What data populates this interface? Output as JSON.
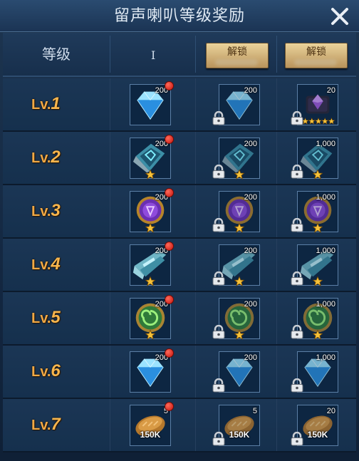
{
  "title": "留声喇叭等级奖励",
  "header": {
    "level_label": "等级",
    "cursor_glyph": "I",
    "unlock_label": "解锁"
  },
  "rows": [
    {
      "level_prefix": "Lv.",
      "level_num": "1",
      "rewards": [
        {
          "item": "blue-diamond-icon",
          "count": "200",
          "locked": false,
          "badge": true,
          "stars": 0
        },
        {
          "item": "blue-diamond-icon",
          "count": "200",
          "locked": true,
          "badge": false,
          "stars": 0
        },
        {
          "item": "purple-crystal-chest-icon",
          "count": "20",
          "locked": true,
          "badge": false,
          "stars": 5
        }
      ]
    },
    {
      "level_prefix": "Lv.",
      "level_num": "2",
      "rewards": [
        {
          "item": "teal-rune-scroll-icon",
          "count": "200",
          "locked": false,
          "badge": true,
          "stars": 1
        },
        {
          "item": "teal-rune-scroll-icon",
          "count": "200",
          "locked": true,
          "badge": false,
          "stars": 1
        },
        {
          "item": "teal-rune-scroll-icon",
          "count": "1,000",
          "locked": true,
          "badge": false,
          "stars": 1
        }
      ]
    },
    {
      "level_prefix": "Lv.",
      "level_num": "3",
      "rewards": [
        {
          "item": "purple-rune-medal-icon",
          "count": "200",
          "locked": false,
          "badge": true,
          "stars": 1
        },
        {
          "item": "purple-rune-medal-icon",
          "count": "200",
          "locked": true,
          "badge": false,
          "stars": 1
        },
        {
          "item": "purple-rune-medal-icon",
          "count": "1,000",
          "locked": true,
          "badge": false,
          "stars": 1
        }
      ]
    },
    {
      "level_prefix": "Lv.",
      "level_num": "4",
      "rewards": [
        {
          "item": "crystal-shard-icon",
          "count": "200",
          "locked": false,
          "badge": true,
          "stars": 1
        },
        {
          "item": "crystal-shard-icon",
          "count": "200",
          "locked": true,
          "badge": false,
          "stars": 1
        },
        {
          "item": "crystal-shard-icon",
          "count": "1,000",
          "locked": true,
          "badge": false,
          "stars": 1
        }
      ]
    },
    {
      "level_prefix": "Lv.",
      "level_num": "5",
      "rewards": [
        {
          "item": "green-swirl-medal-icon",
          "count": "200",
          "locked": false,
          "badge": true,
          "stars": 1
        },
        {
          "item": "green-swirl-medal-icon",
          "count": "200",
          "locked": true,
          "badge": false,
          "stars": 1
        },
        {
          "item": "green-swirl-medal-icon",
          "count": "1,000",
          "locked": true,
          "badge": false,
          "stars": 1
        }
      ]
    },
    {
      "level_prefix": "Lv.",
      "level_num": "6",
      "rewards": [
        {
          "item": "blue-diamond-icon",
          "count": "200",
          "locked": false,
          "badge": true,
          "stars": 0
        },
        {
          "item": "blue-diamond-icon",
          "count": "200",
          "locked": true,
          "badge": false,
          "stars": 0
        },
        {
          "item": "blue-diamond-icon",
          "count": "1,000",
          "locked": true,
          "badge": false,
          "stars": 0
        }
      ]
    },
    {
      "level_prefix": "Lv.",
      "level_num": "7",
      "rewards": [
        {
          "item": "bread-icon",
          "count": "5",
          "label": "150K",
          "locked": false,
          "badge": true,
          "stars": 0
        },
        {
          "item": "bread-icon",
          "count": "5",
          "label": "150K",
          "locked": true,
          "badge": false,
          "stars": 0
        },
        {
          "item": "bread-icon",
          "count": "20",
          "label": "150K",
          "locked": true,
          "badge": false,
          "stars": 0
        }
      ]
    }
  ],
  "colors": {
    "level_text": "#f0a845",
    "unlock_button": "#d9bd83",
    "badge_red": "#d31c12",
    "panel_bg": "#15304d"
  }
}
